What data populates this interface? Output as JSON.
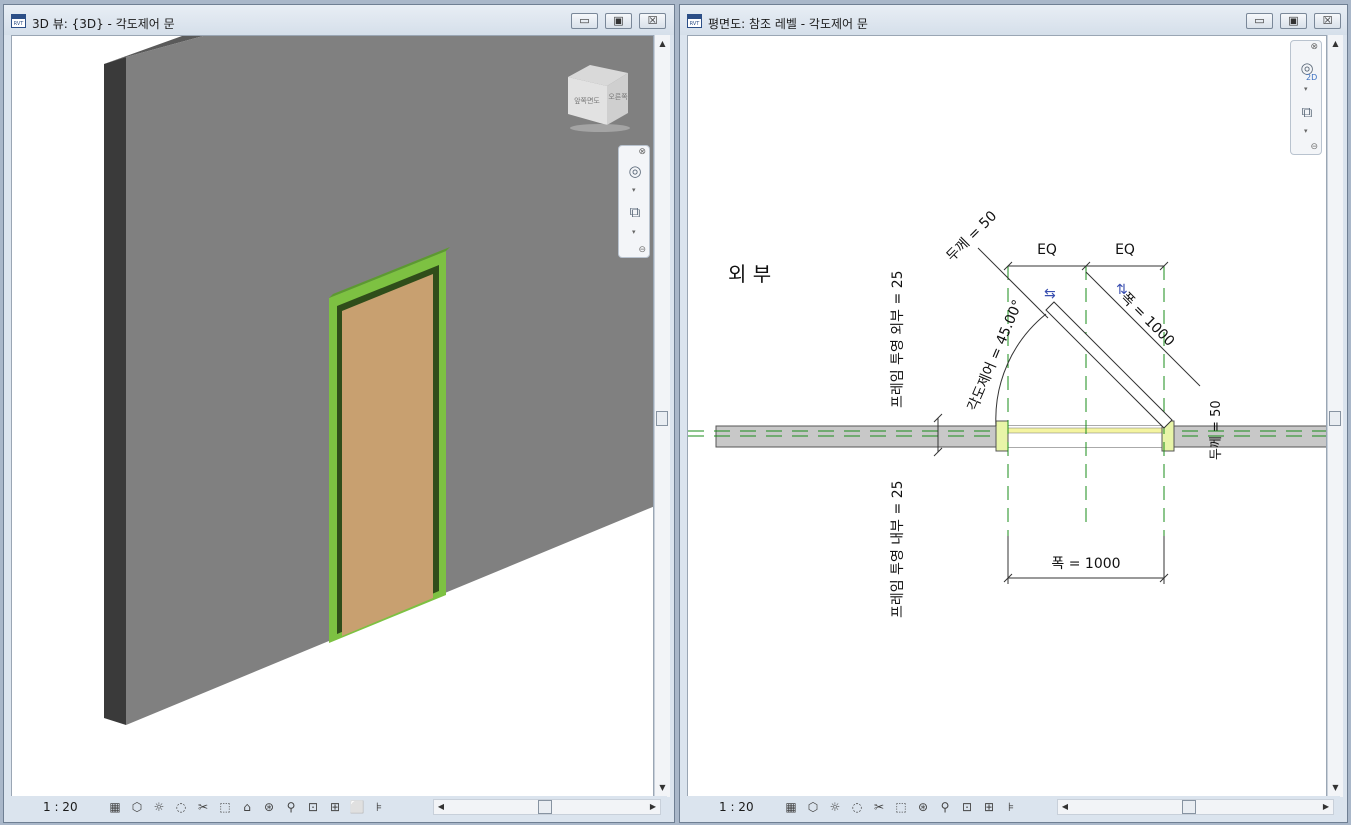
{
  "left_window": {
    "title": "3D 뷰: {3D} - 각도제어 문",
    "icon": "revit-file-icon",
    "buttons": {
      "minimize": "▭",
      "restore": "▣",
      "close": "☒"
    },
    "viewcube_labels": {
      "front": "앞쪽면도",
      "side": "오른쪽"
    },
    "status": {
      "scale": "1 : 20"
    }
  },
  "right_window": {
    "title": "평면도: 참조 레벨 - 각도제어 문",
    "icon": "revit-file-icon",
    "buttons": {
      "minimize": "▭",
      "restore": "▣",
      "close": "☒"
    },
    "status": {
      "scale": "1 : 20"
    },
    "navbar_2d_label": "2D",
    "drawing": {
      "exterior_label": "외 부",
      "eq_left": "EQ",
      "eq_right": "EQ",
      "thickness_top": "두께 = 50",
      "angle": "각도제어 = 45.00°",
      "width_diag": "폭 = 1000",
      "thickness_right": "두께 = 50",
      "width_bottom": "폭 = 1000",
      "frame_exterior": "프레임 투영 외부 = 25",
      "frame_interior": "프레임 투영 내부 = 25"
    }
  },
  "colors": {
    "wall": "#808080",
    "wall_side": "#3a3a3a",
    "frame": "#7dc142",
    "door": "#c8a070",
    "ref_line": "#1a8c1a",
    "plan_wall": "#c8c8c8"
  }
}
